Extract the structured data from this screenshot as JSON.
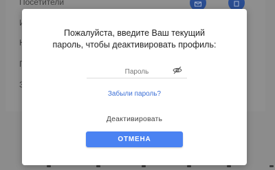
{
  "background": {
    "top_label": "Посетители",
    "side_letters": [
      "И",
      "Н",
      "П",
      "З"
    ]
  },
  "modal": {
    "title_line1": "Пожалуйста, введите Ваш текущий",
    "title_line2": "пароль, чтобы деактивировать профиль:",
    "password_placeholder": "Пароль",
    "password_value": "",
    "forgot_password": "Забыли пароль?",
    "deactivate_label": "Деактивировать",
    "cancel_label": "ОТМЕНА"
  },
  "colors": {
    "accent": "#4a82f2",
    "link": "#3b6fd6",
    "overlay": "#8c8c8c"
  },
  "icons": {
    "password_toggle": "eye-off-icon",
    "bg_button_1": "mail-icon",
    "bg_button_2": "delete-icon"
  }
}
